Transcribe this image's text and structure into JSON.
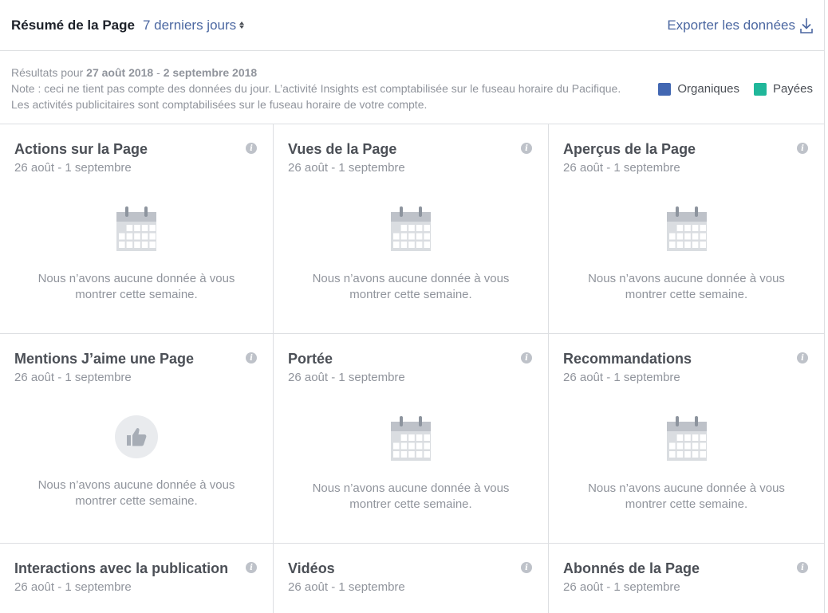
{
  "header": {
    "title": "Résumé de la Page",
    "period": "7 derniers jours",
    "export": "Exporter les données"
  },
  "info": {
    "prefix": "Résultats pour ",
    "start": "27 août 2018",
    "sep": " - ",
    "end": "2 septembre 2018",
    "note": "Note : ceci ne tient pas compte des données du jour. L’activité Insights est comptabilisée sur le fuseau horaire du Pacifique. Les activités publicitaires sont comptabilisées sur le fuseau horaire de votre compte."
  },
  "legend": [
    {
      "label": "Organiques",
      "color": "#4267b2"
    },
    {
      "label": "Payées",
      "color": "#20b79a"
    }
  ],
  "empty_text_line1": "Nous n’avons aucune donnée à vous",
  "empty_text_line2": "montrer cette semaine.",
  "cards": [
    {
      "title": "Actions sur la Page",
      "date": "26 août - 1 septembre",
      "icon": "calendar-icon"
    },
    {
      "title": "Vues de la Page",
      "date": "26 août - 1 septembre",
      "icon": "calendar-icon"
    },
    {
      "title": "Aperçus de la Page",
      "date": "26 août - 1 septembre",
      "icon": "calendar-icon"
    },
    {
      "title": "Mentions J’aime une Page",
      "date": "26 août - 1 septembre",
      "icon": "thumbs-up-icon"
    },
    {
      "title": "Portée",
      "date": "26 août - 1 septembre",
      "icon": "calendar-icon"
    },
    {
      "title": "Recommandations",
      "date": "26 août - 1 septembre",
      "icon": "calendar-icon"
    },
    {
      "title": "Interactions avec la publication",
      "date": "26 août - 1 septembre",
      "icon": ""
    },
    {
      "title": "Vidéos",
      "date": "26 août - 1 septembre",
      "icon": ""
    },
    {
      "title": "Abonnés de la Page",
      "date": "26 août - 1 septembre",
      "icon": ""
    }
  ],
  "info_icon_glyph": "i"
}
